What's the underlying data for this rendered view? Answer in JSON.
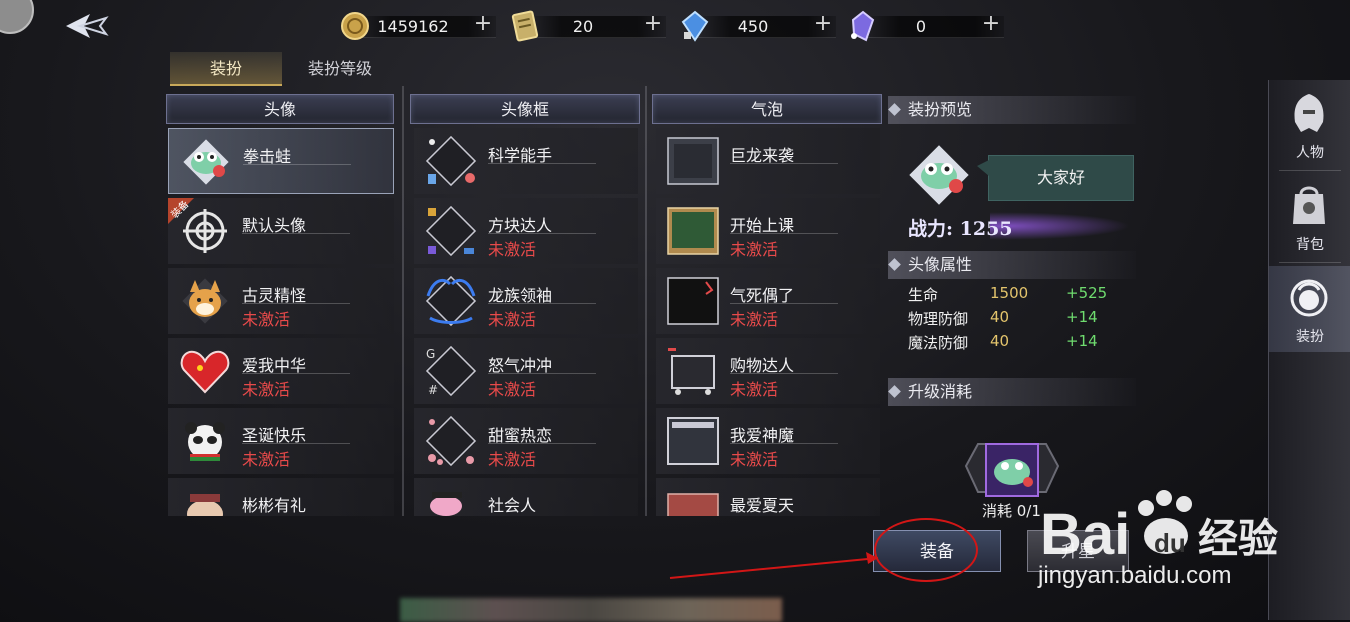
{
  "currencies": [
    {
      "icon": "gold-coin-icon",
      "value": "1459162",
      "add": "+"
    },
    {
      "icon": "scroll-ticket-icon",
      "value": "20",
      "add": "+"
    },
    {
      "icon": "blue-crystal-icon",
      "value": "450",
      "add": "+"
    },
    {
      "icon": "purple-crystal-icon",
      "value": "0",
      "add": "+"
    }
  ],
  "tabs": [
    {
      "label": "装扮",
      "active": true
    },
    {
      "label": "装扮等级",
      "active": false
    }
  ],
  "columns": {
    "avatar": {
      "title": "头像",
      "items": [
        {
          "name": "拳击蛙",
          "status": "",
          "selected": true
        },
        {
          "name": "默认头像",
          "status": "",
          "badge": "装备"
        },
        {
          "name": "古灵精怪",
          "status": "未激活"
        },
        {
          "name": "爱我中华",
          "status": "未激活"
        },
        {
          "name": "圣诞快乐",
          "status": "未激活"
        },
        {
          "name": "彬彬有礼",
          "status": ""
        }
      ]
    },
    "frame": {
      "title": "头像框",
      "items": [
        {
          "name": "科学能手",
          "status": ""
        },
        {
          "name": "方块达人",
          "status": "未激活"
        },
        {
          "name": "龙族领袖",
          "status": "未激活"
        },
        {
          "name": "怒气冲冲",
          "status": "未激活"
        },
        {
          "name": "甜蜜热恋",
          "status": "未激活"
        },
        {
          "name": "社会人",
          "status": ""
        }
      ]
    },
    "bubble": {
      "title": "气泡",
      "items": [
        {
          "name": "巨龙来袭",
          "status": ""
        },
        {
          "name": "开始上课",
          "status": "未激活"
        },
        {
          "name": "气死偶了",
          "status": "未激活"
        },
        {
          "name": "购物达人",
          "status": "未激活"
        },
        {
          "name": "我爱神魔",
          "status": "未激活"
        },
        {
          "name": "最爱夏天",
          "status": ""
        }
      ]
    }
  },
  "preview": {
    "title": "装扮预览",
    "speech": "大家好",
    "power": "战力: 1255"
  },
  "attributes": {
    "title": "头像属性",
    "rows": [
      {
        "key": "生命",
        "value": "1500",
        "delta": "+525"
      },
      {
        "key": "物理防御",
        "value": "40",
        "delta": "+14"
      },
      {
        "key": "魔法防御",
        "value": "40",
        "delta": "+14"
      }
    ]
  },
  "upgrade_cost": {
    "title": "升级消耗",
    "label": "消耗 0/1"
  },
  "buttons": {
    "equip": "装备",
    "upgrade": "升星"
  },
  "side_nav": [
    {
      "label": "人物",
      "icon": "helmet-icon",
      "active": false
    },
    {
      "label": "背包",
      "icon": "bag-icon",
      "active": false
    },
    {
      "label": "装扮",
      "icon": "face-icon",
      "active": true
    }
  ],
  "watermark": {
    "brand_a": "Bai",
    "brand_b": "du",
    "brand_c": "经验",
    "url": "jingyan.baidu.com"
  },
  "colors": {
    "locked_text": "#e84a4a",
    "attr_value": "#e3c46c",
    "attr_delta": "#6fdc6f",
    "annotation_red": "#d21616"
  }
}
